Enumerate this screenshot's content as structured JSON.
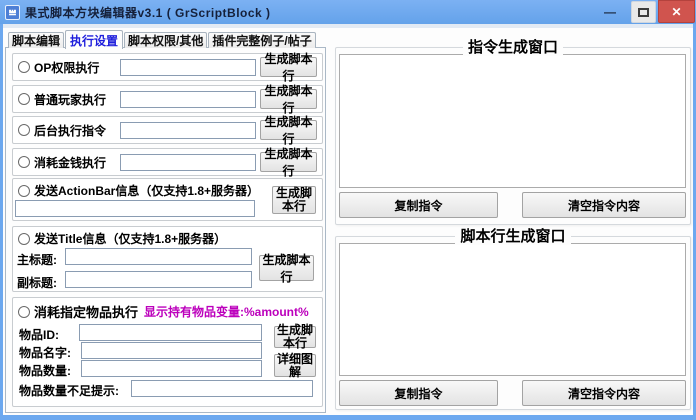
{
  "window": {
    "title": "果式脚本方块编辑器v3.1 ( GrScriptBlock )",
    "minimize_glyph": "—",
    "close_glyph": "✕"
  },
  "colors": {
    "titlebar_blue": "#6CA8EF",
    "close_button_red": "#D0544E",
    "selected_tab_text": "#1E1EDC",
    "hint_magenta": "#BC00BC"
  },
  "tabs": [
    {
      "label": "脚本编辑"
    },
    {
      "label": "执行设置"
    },
    {
      "label": "脚本权限/其他"
    },
    {
      "label": "插件完整例子/帖子"
    }
  ],
  "simple_rows": [
    {
      "label": "OP权限执行",
      "value": "",
      "button": "生成脚本行"
    },
    {
      "label": "普通玩家执行",
      "value": "",
      "button": "生成脚本行"
    },
    {
      "label": "后台执行指令",
      "value": "",
      "button": "生成脚本行"
    },
    {
      "label": "消耗金钱执行",
      "value": "",
      "button": "生成脚本行"
    }
  ],
  "actionbar_group": {
    "label": "发送ActionBar信息（仅支持1.8+服务器）",
    "value": "",
    "button": "生成脚本行"
  },
  "title_group": {
    "label": "发送Title信息（仅支持1.8+服务器）",
    "main_label": "主标题:",
    "main_value": "",
    "sub_label": "副标题:",
    "sub_value": "",
    "button": "生成脚本行"
  },
  "item_group": {
    "label": "消耗指定物品执行",
    "hint": "显示持有物品变量:%amount%",
    "id_label": "物品ID:",
    "id_value": "",
    "name_label": "物品名字:",
    "name_value": "",
    "count_label": "物品数量:",
    "count_value": "",
    "warn_label": "物品数量不足提示:",
    "warn_value": "",
    "generate_button": "生成脚本行",
    "detail_button": "详细图解"
  },
  "panels": [
    {
      "title": "指令生成窗口",
      "content": "",
      "copy_button": "复制指令",
      "clear_button": "清空指令内容"
    },
    {
      "title": "脚本行生成窗口",
      "content": "",
      "copy_button": "复制指令",
      "clear_button": "清空指令内容"
    }
  ]
}
